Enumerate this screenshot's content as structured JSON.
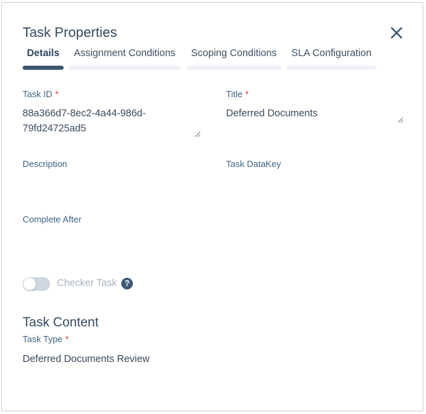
{
  "dialog": {
    "title": "Task Properties",
    "close_icon": "close-icon"
  },
  "tabs": [
    {
      "label": "Details",
      "active": true
    },
    {
      "label": "Assignment Conditions",
      "active": false
    },
    {
      "label": "Scoping Conditions",
      "active": false
    },
    {
      "label": "SLA Configuration",
      "active": false
    }
  ],
  "fields": {
    "task_id": {
      "label": "Task ID",
      "required_mark": "*",
      "value": "88a366d7-8ec2-4a44-986d-\n79fd24725ad5"
    },
    "title": {
      "label": "Title",
      "required_mark": "*",
      "value": "Deferred Documents"
    },
    "description": {
      "label": "Description",
      "value": ""
    },
    "task_datakey": {
      "label": "Task DataKey",
      "value": ""
    },
    "complete_after": {
      "label": "Complete After",
      "value": ""
    }
  },
  "checker_task": {
    "label": "Checker Task",
    "enabled": false,
    "help_icon": "question-icon",
    "help_glyph": "?"
  },
  "task_content": {
    "heading": "Task Content",
    "task_type": {
      "label": "Task Type",
      "required_mark": "*",
      "value": "Deferred Documents Review"
    }
  },
  "colors": {
    "accent": "#3b5670",
    "label": "#3f6384",
    "required": "#e0303a",
    "tab_track": "#eef1f5"
  }
}
